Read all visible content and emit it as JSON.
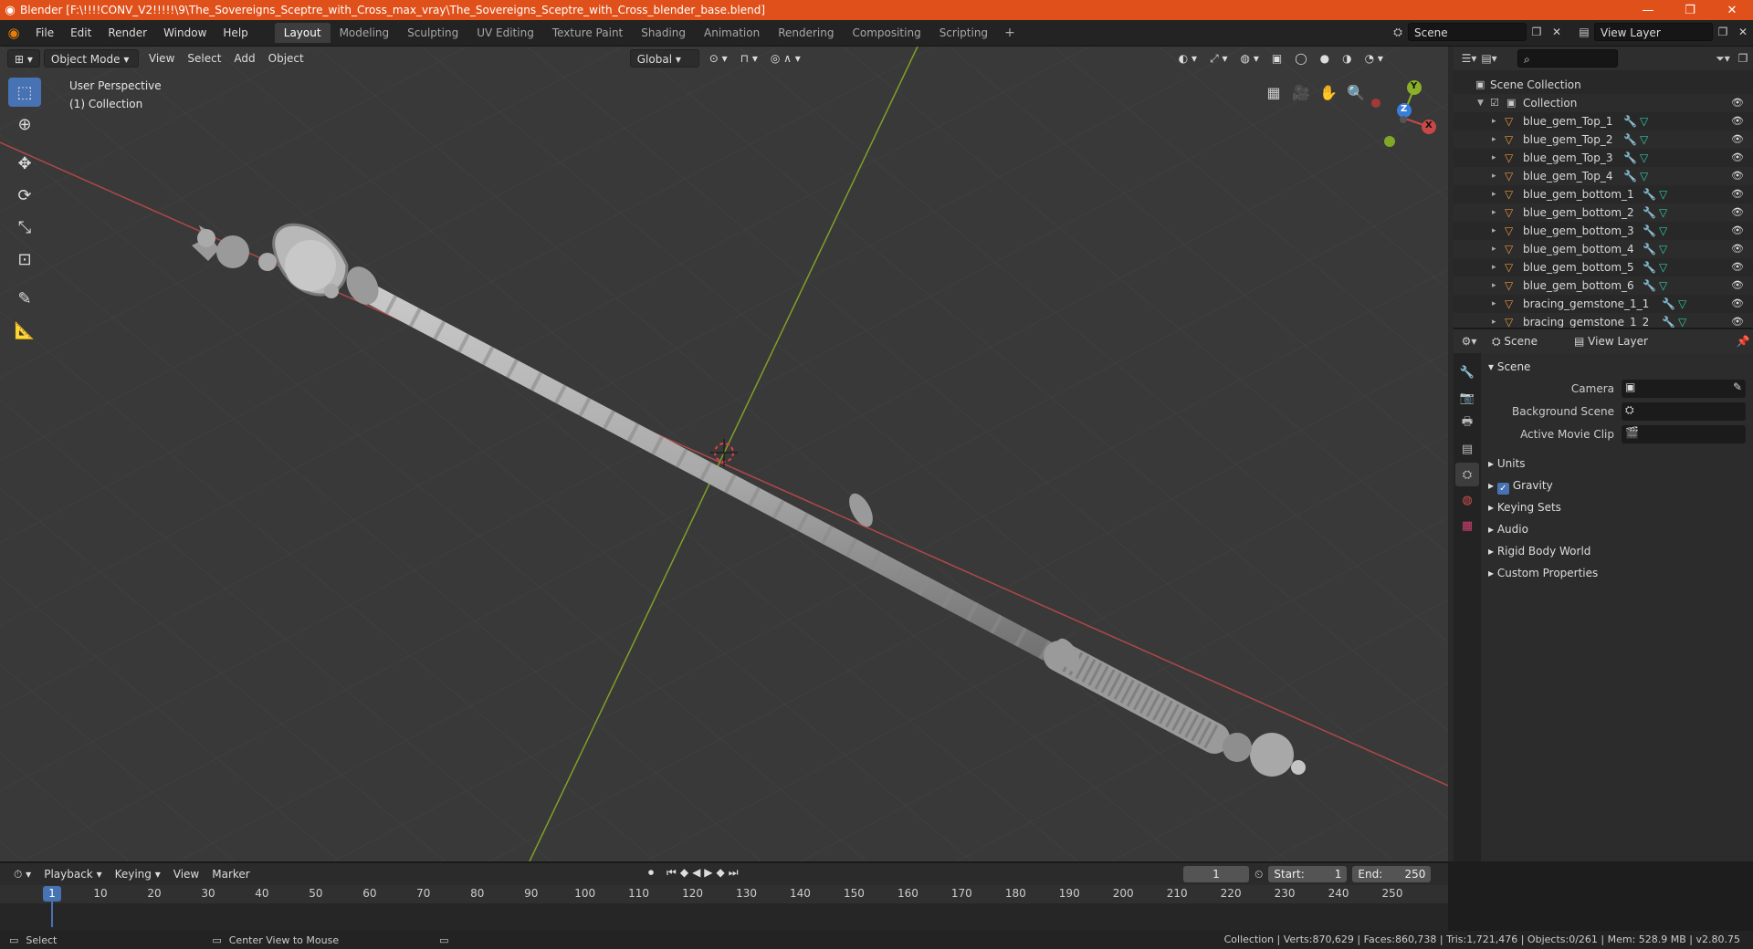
{
  "titlebar": {
    "title": "Blender [F:\\!!!!CONV_V2!!!!!\\9\\The_Sovereigns_Sceptre_with_Cross_max_vray\\The_Sovereigns_Sceptre_with_Cross_blender_base.blend]",
    "minimize": "—",
    "restore": "❐",
    "close": "✕"
  },
  "menu": [
    "File",
    "Edit",
    "Render",
    "Window",
    "Help"
  ],
  "workspaces": [
    "Layout",
    "Modeling",
    "Sculpting",
    "UV Editing",
    "Texture Paint",
    "Shading",
    "Animation",
    "Rendering",
    "Compositing",
    "Scripting"
  ],
  "active_workspace": "Layout",
  "scene_field": "Scene",
  "view_layer_field": "View Layer",
  "viewport": {
    "mode": "Object Mode",
    "menus": [
      "View",
      "Select",
      "Add",
      "Object"
    ],
    "transform_orientation": "Global",
    "perspective_label": "User Perspective",
    "collection_label": "(1) Collection",
    "gizmo": {
      "x": "X",
      "y": "Y",
      "z": "Z"
    }
  },
  "outliner": {
    "root": "Scene Collection",
    "collection": "Collection",
    "items": [
      "blue_gem_Top_1",
      "blue_gem_Top_2",
      "blue_gem_Top_3",
      "blue_gem_Top_4",
      "blue_gem_bottom_1",
      "blue_gem_bottom_2",
      "blue_gem_bottom_3",
      "blue_gem_bottom_4",
      "blue_gem_bottom_5",
      "blue_gem_bottom_6",
      "bracing_gemstone_1_1",
      "bracing_gemstone_1_2"
    ]
  },
  "properties": {
    "header_scene": "Scene",
    "header_view_layer": "View Layer",
    "panel_title": "Scene",
    "rows": [
      {
        "label": "Camera"
      },
      {
        "label": "Background Scene"
      },
      {
        "label": "Active Movie Clip"
      }
    ],
    "subpanels": [
      "Units",
      "Gravity",
      "Keying Sets",
      "Audio",
      "Rigid Body World",
      "Custom Properties"
    ]
  },
  "timeline": {
    "menus": [
      "Playback",
      "Keying",
      "View",
      "Marker"
    ],
    "current_frame": "1",
    "start_label": "Start:",
    "start": "1",
    "end_label": "End:",
    "end": "250",
    "ticks": [
      "1",
      "10",
      "20",
      "30",
      "40",
      "50",
      "60",
      "70",
      "80",
      "90",
      "100",
      "110",
      "120",
      "130",
      "140",
      "150",
      "160",
      "170",
      "180",
      "190",
      "200",
      "210",
      "220",
      "230",
      "240",
      "250"
    ]
  },
  "statusbar": {
    "select": "Select",
    "center_view": "Center View to Mouse",
    "stats": "Collection | Verts:870,629 | Faces:860,738 | Tris:1,721,476 | Objects:0/261 | Mem: 528.9 MB | v2.80.75"
  },
  "colors": {
    "title_bar": "#e0501a",
    "accent": "#4772b3",
    "viewport_bg": "#393939",
    "x_axis": "#c84848",
    "y_axis": "#8ab02a",
    "object_icon": "#e8963a",
    "mesh_icon": "#30c8a8"
  },
  "icons": {
    "blender": "blender-logo-icon",
    "eye": "eye-icon",
    "wrench": "wrench-icon",
    "mesh": "mesh-data-icon"
  }
}
